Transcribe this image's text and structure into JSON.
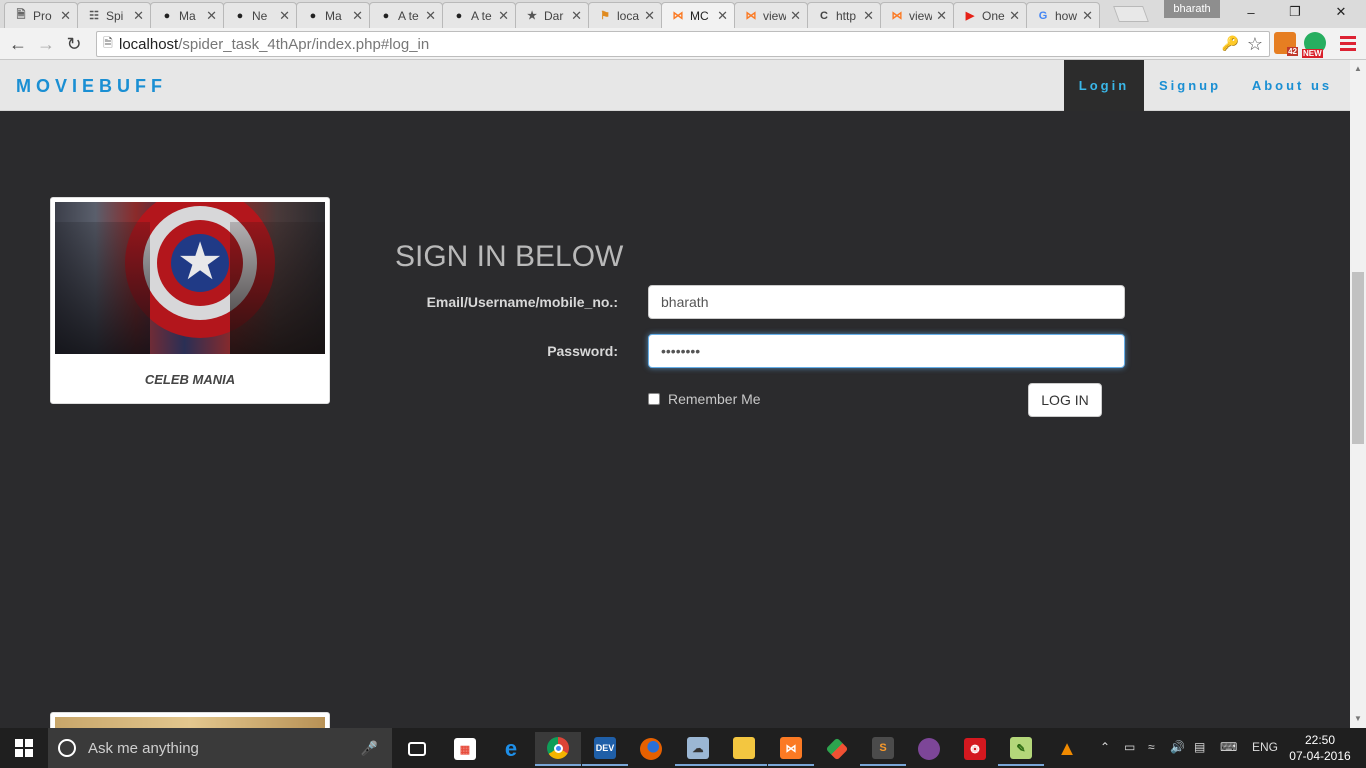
{
  "browser": {
    "tabs": [
      {
        "title": "Pro",
        "icon": "document-icon"
      },
      {
        "title": "Spi",
        "icon": "spider-icon"
      },
      {
        "title": "Ma",
        "icon": "github-icon"
      },
      {
        "title": "Ne",
        "icon": "github-icon"
      },
      {
        "title": "Ma",
        "icon": "github-icon"
      },
      {
        "title": "A te",
        "icon": "github-icon"
      },
      {
        "title": "A te",
        "icon": "github-icon"
      },
      {
        "title": "Dar",
        "icon": "star-icon"
      },
      {
        "title": "loca",
        "icon": "phpmyadmin-icon"
      },
      {
        "title": "MC",
        "icon": "xampp-icon",
        "active": true
      },
      {
        "title": "view",
        "icon": "xampp-icon"
      },
      {
        "title": "http",
        "icon": "c-icon"
      },
      {
        "title": "view",
        "icon": "xampp-icon"
      },
      {
        "title": "One",
        "icon": "youtube-icon"
      },
      {
        "title": "how",
        "icon": "google-icon"
      }
    ],
    "profile_name": "bharath",
    "url_host": "localhost",
    "url_path": "/spider_task_4thApr/index.php#log_in",
    "extension_badge_count": "42",
    "extension_badge_new": "NEW"
  },
  "site": {
    "brand": "MOVIEBUFF",
    "nav": {
      "login": "Login",
      "signup": "Signup",
      "about": "About us"
    },
    "card": {
      "caption": "CELEB MANIA"
    },
    "form": {
      "title": "SIGN IN BELOW",
      "username_label": "Email/Username/mobile_no.:",
      "username_value": "bharath",
      "password_label": "Password:",
      "password_value": "••••••••",
      "remember_label": "Remember Me",
      "login_button": "LOG IN"
    }
  },
  "taskbar": {
    "search_placeholder": "Ask me anything",
    "language": "ENG",
    "time": "22:50",
    "date": "07-04-2016"
  },
  "colors": {
    "brand_blue": "#1a8fd3",
    "page_bg": "#2b2b2d",
    "navbar_bg": "#e7e7e7"
  }
}
